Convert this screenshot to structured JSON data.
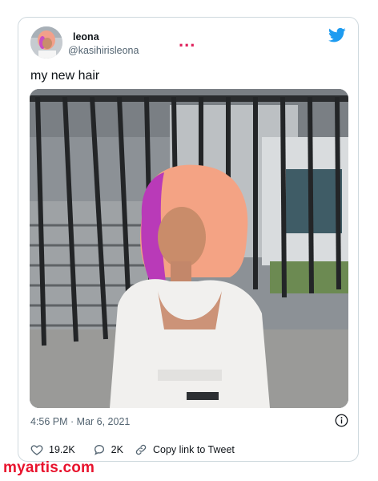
{
  "tweet": {
    "author": {
      "display_name": "leona",
      "handle": "@kasihirisleona",
      "avatar": "avatar-photo"
    },
    "more_menu": "...",
    "platform_icon": "twitter-bird-icon",
    "text": "my new hair",
    "photo": "photo of a woman with peach-pink bob hair sitting by a metal railing",
    "timestamp": "4:56 PM · Mar 6, 2021",
    "info_icon": "info-icon",
    "actions": {
      "likes": "19.2K",
      "replies": "2K",
      "copy_link": "Copy link to Tweet"
    }
  },
  "watermark": "myartis.com",
  "colors": {
    "accent": "#1d9bf0",
    "dots": "#e0245e",
    "watermark": "#e8132d",
    "muted_text": "#536471",
    "border": "#cfd9de"
  }
}
